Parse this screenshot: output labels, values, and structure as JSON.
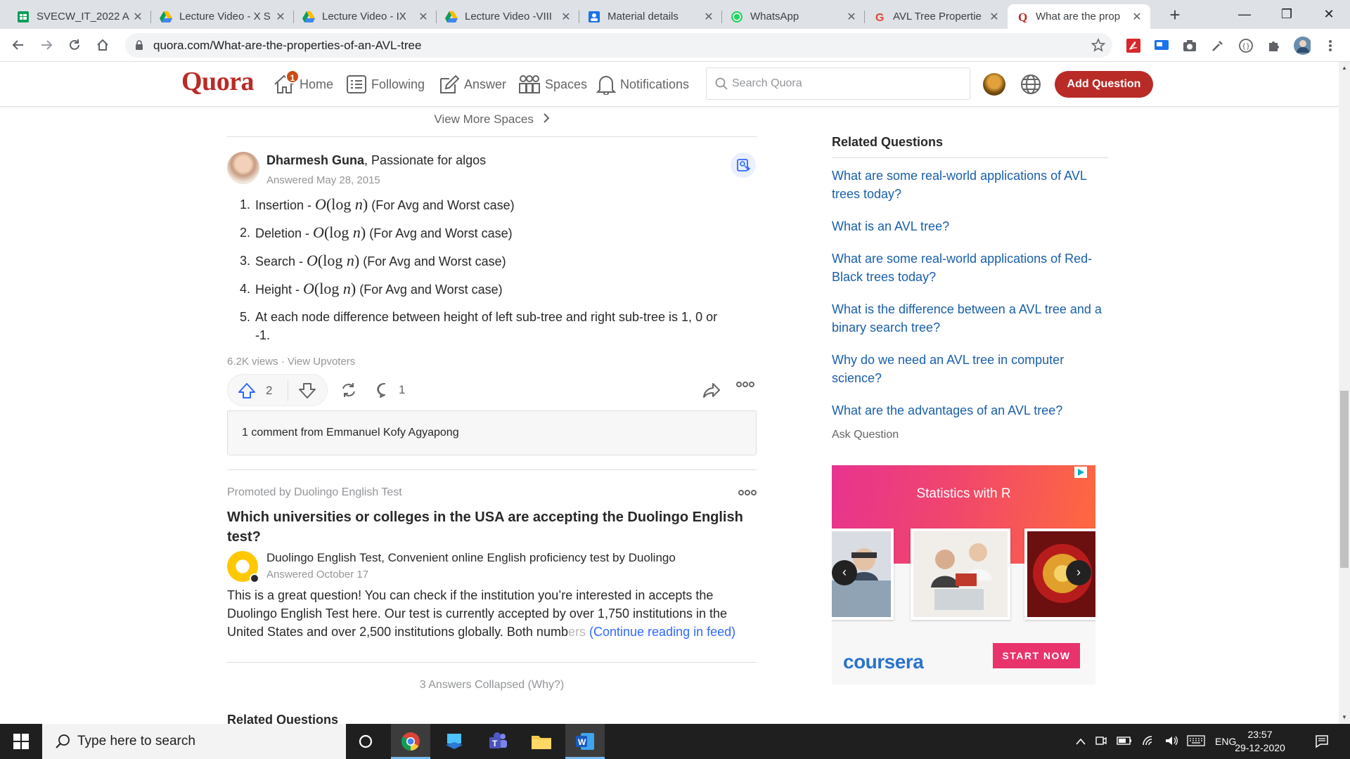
{
  "browser": {
    "tabs": [
      {
        "title": "SVECW_IT_2022 A",
        "icon": "sheets-icon",
        "active": false
      },
      {
        "title": "Lecture Video - X S",
        "icon": "drive-icon",
        "active": false
      },
      {
        "title": "Lecture Video - IX",
        "icon": "drive-icon",
        "active": false
      },
      {
        "title": "Lecture Video -VIII",
        "icon": "drive-icon",
        "active": false
      },
      {
        "title": "Material details",
        "icon": "contacts-icon",
        "active": false
      },
      {
        "title": "WhatsApp",
        "icon": "whatsapp-icon",
        "active": false
      },
      {
        "title": "AVL Tree Propertie",
        "icon": "g-icon",
        "active": false
      },
      {
        "title": "What are the prop",
        "icon": "quora-icon",
        "active": true
      }
    ],
    "url": "quora.com/What-are-the-properties-of-an-AVL-tree"
  },
  "quora": {
    "logo": "Quora",
    "nav": {
      "home": "Home",
      "home_badge": "1",
      "following": "Following",
      "answer": "Answer",
      "spaces": "Spaces",
      "notifications": "Notifications"
    },
    "search_placeholder": "Search Quora",
    "add_question": "Add Question",
    "brand_color": "#b92b27"
  },
  "answer": {
    "view_more_spaces": "View More Spaces",
    "author_name": "Dharmesh Guna",
    "author_credential": ", Passionate for algos",
    "answered": "Answered May 28, 2015",
    "items": [
      {
        "num": "1.",
        "pre": "Insertion - ",
        "post": " (For Avg and Worst case)"
      },
      {
        "num": "2.",
        "pre": "Deletion - ",
        "post": " (For Avg and Worst case)"
      },
      {
        "num": "3.",
        "pre": "Search - ",
        "post": " (For Avg and Worst case)"
      },
      {
        "num": "4.",
        "pre": "Height - ",
        "post": " (For Avg and Worst case)"
      },
      {
        "num": "5.",
        "text": "At each node difference between height of left sub-tree and right sub-tree is 1, 0 or -1."
      }
    ],
    "views": "6.2K views · View Upvoters",
    "upvotes": "2",
    "comments": "1",
    "comment_preview": "1 comment from Emmanuel Kofy Agyapong"
  },
  "promo": {
    "promoted_by": "Promoted by Duolingo English Test",
    "question": "Which universities or colleges in the USA are accepting the Duolingo English test?",
    "author": "Duolingo English Test, Convenient online English proficiency test by Duolingo",
    "answered": "Answered October 17",
    "body": "This is a great question! You can check if the institution you’re interested in accepts the Duolingo English Test here. Our test is currently accepted by over 1,750 institutions in the United States and over 2,500 institutions globally. Both numb",
    "body_fade": "ers",
    "continue": "(Continue reading in feed)"
  },
  "collapsed": "3 Answers Collapsed (Why?)",
  "bottom_related": "Related Questions",
  "sidebar": {
    "title": "Related Questions",
    "questions": [
      "What are some real-world applications of AVL trees today?",
      "What is an AVL tree?",
      "What are some real-world applications of Red-Black trees today?",
      "What is the difference between a AVL tree and a binary search tree?",
      "Why do we need an AVL tree in computer science?",
      "What are the advantages of an AVL tree?"
    ],
    "ask_question": "Ask Question"
  },
  "ad": {
    "title": "Statistics with R",
    "brand": "coursera",
    "cta": "START NOW"
  },
  "taskbar": {
    "search_placeholder": "Type here to search",
    "language": "ENG",
    "time": "23:57",
    "date": "29-12-2020"
  }
}
